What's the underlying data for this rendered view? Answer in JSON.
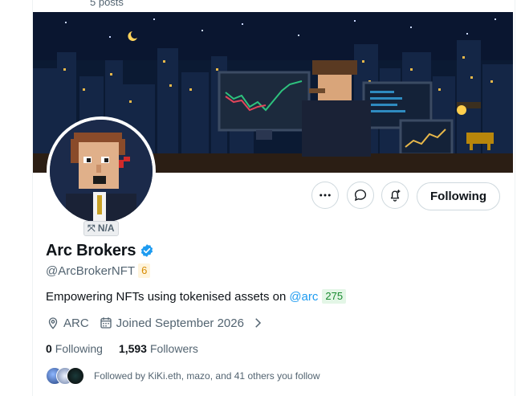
{
  "header": {
    "posts_count": "5 posts"
  },
  "profile": {
    "display_name": "Arc Brokers",
    "handle": "@ArcBrokerNFT",
    "handle_badge": "6",
    "avatar_badge": "⤧ N/A",
    "verified": true
  },
  "actions": {
    "follow_button_label": "Following"
  },
  "bio": {
    "text": "Empowering NFTs using tokenised assets on",
    "mention": "@arc",
    "mention_badge": "275"
  },
  "meta": {
    "location": "ARC",
    "joined": "Joined September 2026"
  },
  "stats": {
    "following_count": "0",
    "following_label": "Following",
    "followers_count": "1,593",
    "followers_label": "Followers"
  },
  "followed_by": {
    "text": "Followed by KiKi.eth, mazo, and 41 others you follow"
  },
  "colors": {
    "accent": "#1d9bf0",
    "text_primary": "#0f1419",
    "text_secondary": "#536471",
    "border": "#cfd9de"
  }
}
